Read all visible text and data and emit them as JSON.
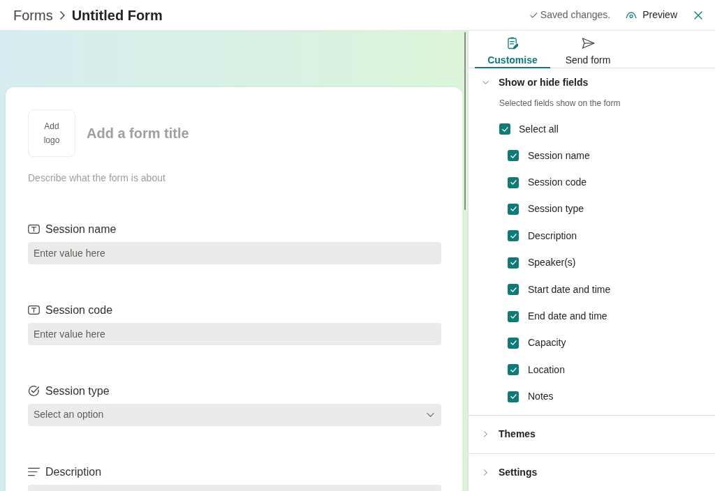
{
  "header": {
    "breadcrumb": [
      {
        "label": "Forms"
      },
      {
        "label": "Untitled Form"
      }
    ],
    "status": "Saved changes.",
    "preview": "Preview"
  },
  "form": {
    "logo_button": "Add logo",
    "title": {
      "placeholder": "Add a form title"
    },
    "description": {
      "placeholder": "Describe what the form is about"
    },
    "fields": [
      {
        "label": "Session name",
        "kind": "text",
        "placeholder": "Enter value here"
      },
      {
        "label": "Session code",
        "kind": "text",
        "placeholder": "Enter value here"
      },
      {
        "label": "Session type",
        "kind": "choice",
        "placeholder": "Select an option"
      },
      {
        "label": "Description",
        "kind": "long_text"
      }
    ]
  },
  "panel": {
    "tabs": [
      {
        "label": "Customise",
        "selected": true
      },
      {
        "label": "Send form",
        "selected": false
      }
    ],
    "sections": [
      {
        "title": "Show or hide fields",
        "expanded": true,
        "hint": "Selected fields show on the form",
        "select_all": {
          "label": "Select all",
          "checked": true
        },
        "options": [
          {
            "label": "Session name",
            "checked": true
          },
          {
            "label": "Session code",
            "checked": true
          },
          {
            "label": "Session type",
            "checked": true
          },
          {
            "label": "Description",
            "checked": true
          },
          {
            "label": "Speaker(s)",
            "checked": true
          },
          {
            "label": "Start date and time",
            "checked": true
          },
          {
            "label": "End date and time",
            "checked": true
          },
          {
            "label": "Capacity",
            "checked": true
          },
          {
            "label": "Location",
            "checked": true
          },
          {
            "label": "Notes",
            "checked": true
          }
        ]
      },
      {
        "title": "Themes",
        "expanded": false
      },
      {
        "title": "Settings",
        "expanded": false
      }
    ]
  }
}
